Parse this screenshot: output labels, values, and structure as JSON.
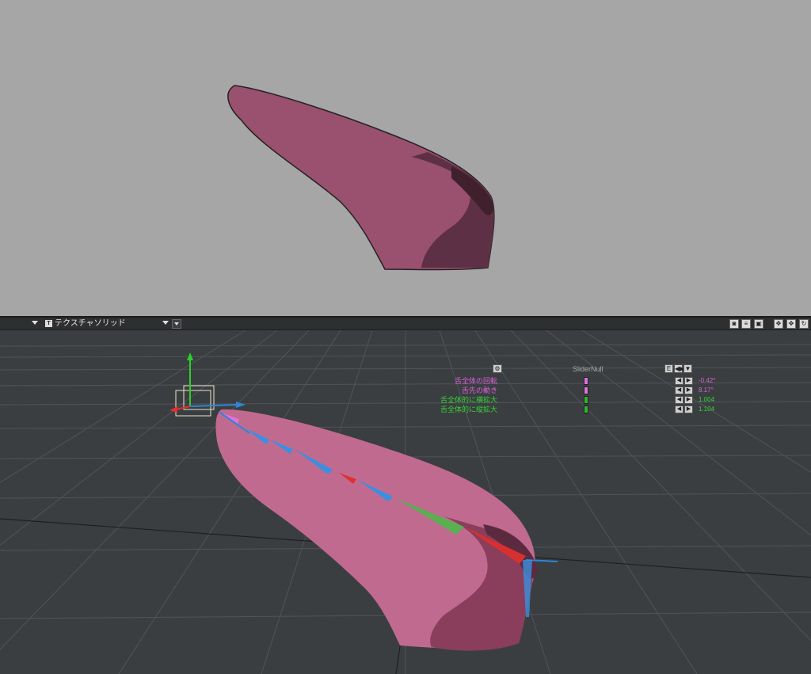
{
  "toolbar": {
    "view_mode_label": "テクスチャソリッド",
    "view_mode_badge": "T",
    "icons": [
      "dropdown-arrow",
      "render-camera-icon",
      "list-icon",
      "save-icon",
      "move-view-icon",
      "pan-view-icon",
      "rotate-view-icon"
    ]
  },
  "slider_panel": {
    "title": "SliderNull",
    "header_buttons": [
      "E",
      "◀▶",
      "▼"
    ],
    "rows": [
      {
        "label": "舌全体の回転",
        "value": "-0.42°",
        "color": "#d860d8",
        "handle_color": "#e070e0"
      },
      {
        "label": "舌先の動き",
        "value": "8.17°",
        "color": "#d860d8",
        "handle_color": "#e070e0"
      },
      {
        "label": "舌全体的に横拡大",
        "value": "1.004",
        "color": "#34d334",
        "handle_color": "#2fb52f"
      },
      {
        "label": "舌全体的に縦拡大",
        "value": "1.104",
        "color": "#34d334",
        "handle_color": "#2fb52f"
      }
    ]
  },
  "colors": {
    "tongue": "#9a506f",
    "tongue_shadow": "#5e3046",
    "tongue_dark": "#41202e",
    "top_bg": "#a6a6a6",
    "bottom_bg": "#3b3e41",
    "grid": "#52565a"
  }
}
